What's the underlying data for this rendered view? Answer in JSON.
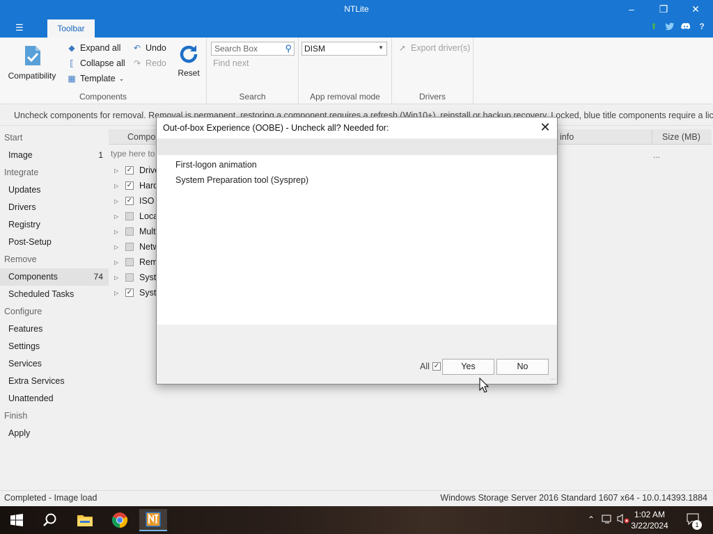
{
  "window": {
    "title": "NTLite"
  },
  "titlebar": {
    "menu_icon": "☰",
    "tab_label": "Toolbar"
  },
  "ribbon": {
    "components_group": {
      "label": "Components",
      "compatibility": "Compatibility",
      "expand_all": "Expand all",
      "collapse_all": "Collapse all",
      "template": "Template",
      "undo": "Undo",
      "redo": "Redo",
      "reset": "Reset"
    },
    "search_group": {
      "label": "Search",
      "placeholder": "Search Box",
      "find_next": "Find next"
    },
    "app_removal_group": {
      "label": "App removal mode",
      "selected": "DISM"
    },
    "drivers_group": {
      "label": "Drivers",
      "export": "Export driver(s)"
    }
  },
  "info_text": "Uncheck components for removal. Removal is permanent, restoring a component requires a refresh (Win10+), reinstall or backup recovery. Locked, blue title components require a license.",
  "sidebar": {
    "start": "Start",
    "image": "Image",
    "image_count": "1",
    "integrate": "Integrate",
    "updates": "Updates",
    "drivers": "Drivers",
    "registry": "Registry",
    "post_setup": "Post-Setup",
    "remove": "Remove",
    "components": "Components",
    "components_count": "74",
    "scheduled_tasks": "Scheduled Tasks",
    "configure": "Configure",
    "features": "Features",
    "settings": "Settings",
    "services": "Services",
    "extra_services": "Extra Services",
    "unattended": "Unattended",
    "finish": "Finish",
    "apply": "Apply"
  },
  "list": {
    "col_component": "Compo",
    "col_info": "info",
    "col_size": "Size (MB)",
    "filter_placeholder": "type here to",
    "filter_dots": "...",
    "rows": [
      {
        "label": "Drive",
        "checked": true
      },
      {
        "label": "Hard",
        "checked": true
      },
      {
        "label": "ISO i",
        "checked": true
      },
      {
        "label": "Loca",
        "checked": false
      },
      {
        "label": "Multi",
        "checked": false
      },
      {
        "label": "Netw",
        "checked": false
      },
      {
        "label": "Remo",
        "checked": false
      },
      {
        "label": "Syste",
        "checked": false
      },
      {
        "label": "Syste",
        "checked": true
      }
    ]
  },
  "status": {
    "left": "Completed - Image load",
    "right": "Windows Storage Server 2016 Standard 1607 x64 - 10.0.14393.1884"
  },
  "dialog": {
    "title": "Out-of-box Experience (OOBE) - Uncheck all? Needed for:",
    "lines": [
      "First-logon animation",
      "System Preparation tool (Sysprep)"
    ],
    "all_label": "All",
    "yes": "Yes",
    "no": "No"
  },
  "taskbar": {
    "time": "1:02 AM",
    "date": "3/22/2024",
    "notification_count": "1"
  },
  "colors": {
    "accent": "#1976d2",
    "tab_text": "#1565c0",
    "taskbar": "#1f1713"
  }
}
